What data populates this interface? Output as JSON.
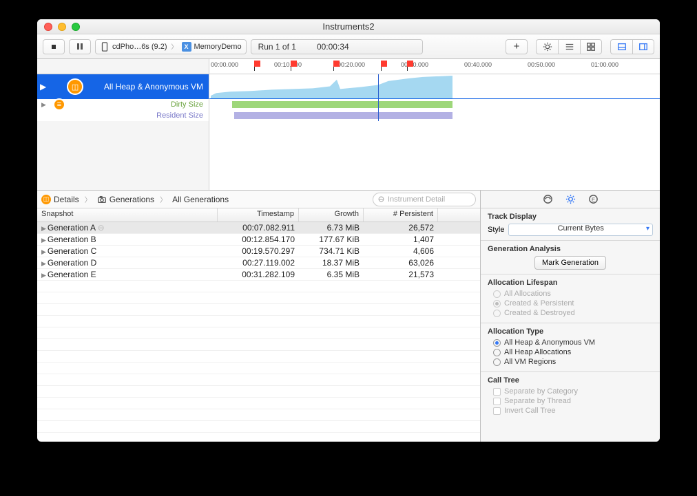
{
  "window": {
    "title": "Instruments2"
  },
  "toolbar": {
    "device": "cdPho…6s (9.2)",
    "target": "MemoryDemo",
    "run_label": "Run 1 of 1",
    "elapsed": "00:00:34"
  },
  "ruler": {
    "ticks": [
      "00:00.000",
      "00:10.000",
      "00:20.000",
      "00:30.000",
      "00:40.000",
      "00:50.000",
      "01:00.000"
    ]
  },
  "tracks": {
    "main": "All Heap & Anonymous VM",
    "dirty": "Dirty Size",
    "resident": "Resident Size"
  },
  "pathbar": {
    "details": "Details",
    "generations": "Generations",
    "all": "All Generations",
    "search_placeholder": "Instrument Detail"
  },
  "table": {
    "headers": {
      "snapshot": "Snapshot",
      "timestamp": "Timestamp",
      "growth": "Growth",
      "persistent": "# Persistent"
    },
    "rows": [
      {
        "name": "Generation A",
        "ts": "00:07.082.911",
        "growth": "6.73 MiB",
        "persistent": "26,572",
        "selected": true
      },
      {
        "name": "Generation B",
        "ts": "00:12.854.170",
        "growth": "177.67 KiB",
        "persistent": "1,407"
      },
      {
        "name": "Generation C",
        "ts": "00:19.570.297",
        "growth": "734.71 KiB",
        "persistent": "4,606"
      },
      {
        "name": "Generation D",
        "ts": "00:27.119.002",
        "growth": "18.37 MiB",
        "persistent": "63,026"
      },
      {
        "name": "Generation E",
        "ts": "00:31.282.109",
        "growth": "6.35 MiB",
        "persistent": "21,573"
      }
    ]
  },
  "inspector": {
    "track_display": {
      "title": "Track Display",
      "style_label": "Style",
      "style_value": "Current Bytes"
    },
    "gen_analysis": {
      "title": "Generation Analysis",
      "button": "Mark Generation"
    },
    "lifespan": {
      "title": "Allocation Lifespan",
      "opts": [
        "All Allocations",
        "Created & Persistent",
        "Created & Destroyed"
      ]
    },
    "alloc_type": {
      "title": "Allocation Type",
      "opts": [
        "All Heap & Anonymous VM",
        "All Heap Allocations",
        "All VM Regions"
      ]
    },
    "call_tree": {
      "title": "Call Tree",
      "opts": [
        "Separate by Category",
        "Separate by Thread",
        "Invert Call Tree"
      ]
    }
  }
}
